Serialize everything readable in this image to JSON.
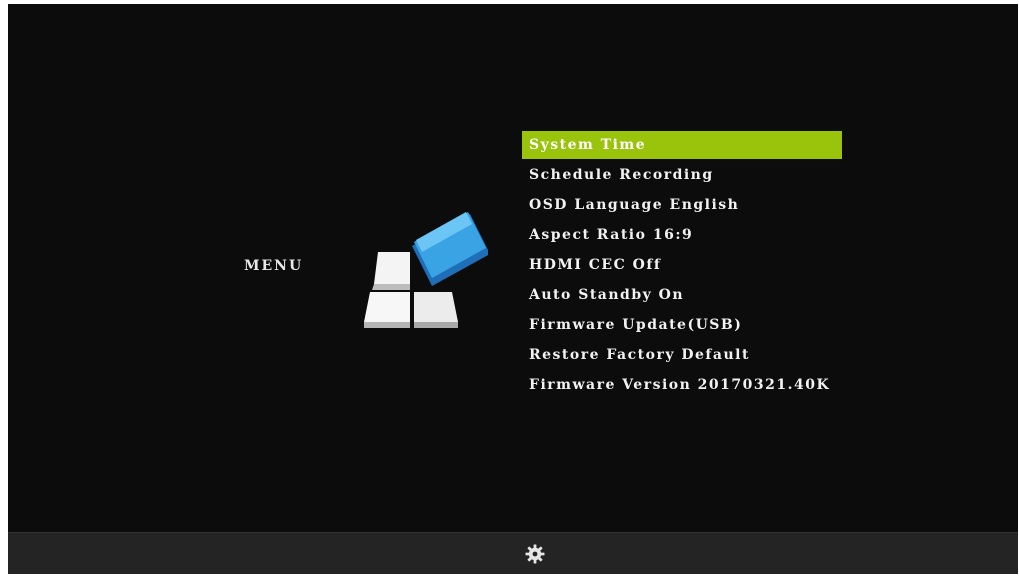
{
  "menu": {
    "title": "MENU",
    "selected_index": 0,
    "selection_color": "#9ac40c",
    "items": [
      {
        "label": "System Time"
      },
      {
        "label": "Schedule Recording"
      },
      {
        "label": "OSD Language English"
      },
      {
        "label": "Aspect Ratio 16:9"
      },
      {
        "label": "HDMI CEC Off"
      },
      {
        "label": "Auto Standby On"
      },
      {
        "label": "Firmware Update(USB)"
      },
      {
        "label": "Restore Factory Default"
      },
      {
        "label": "Firmware Version 20170321.40K"
      }
    ]
  },
  "logo": {
    "icon": "settings-cube-logo"
  },
  "bottom_bar": {
    "icon": "gear-icon"
  }
}
